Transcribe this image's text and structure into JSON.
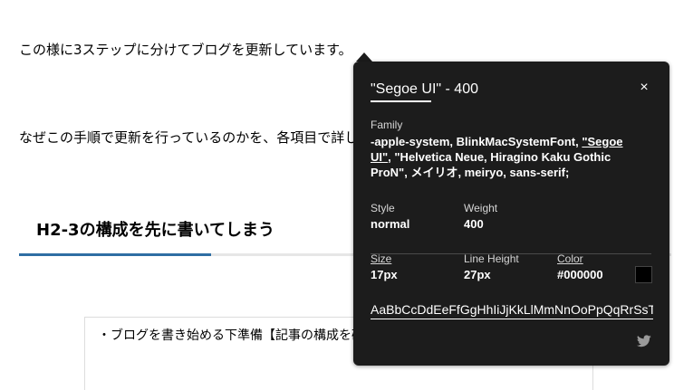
{
  "article": {
    "paragraph1": "この様に3ステップに分けてブログを更新しています。",
    "paragraph2": "なぜこの手順で更新を行っているのかを、各項目で詳しく解説します。",
    "heading": "H2-3の構成を先に書いてしまう",
    "box_line": "・ブログを書き始める下準備【記事の構成を確認してからブログを書く】"
  },
  "inspector": {
    "title": "\"Segoe UI\" - 400",
    "close_glyph": "×",
    "family_label": "Family",
    "family_before": "-apple-system, BlinkMacSystemFont, ",
    "family_highlight": "\"Segoe UI\"",
    "family_after": ", \"Helvetica Neue, Hiragino Kaku Gothic ProN\", メイリオ, meiryo, sans-serif;",
    "style_label": "Style",
    "style_value": "normal",
    "weight_label": "Weight",
    "weight_value": "400",
    "size_label": "Size",
    "size_value": "17px",
    "line_height_label": "Line Height",
    "line_height_value": "27px",
    "color_label": "Color",
    "color_value": "#000000",
    "swatch_color": "#000000",
    "sample_text": "AaBbCcDdEeFfGgHhIiJjKkLlMmNnOoPpQqRrSsTtUuVvWwXxYyZz",
    "share_icon": "twitter-icon"
  },
  "colors": {
    "popup_bg": "#1c1c1c",
    "heading_accent": "#2e6ea3"
  }
}
